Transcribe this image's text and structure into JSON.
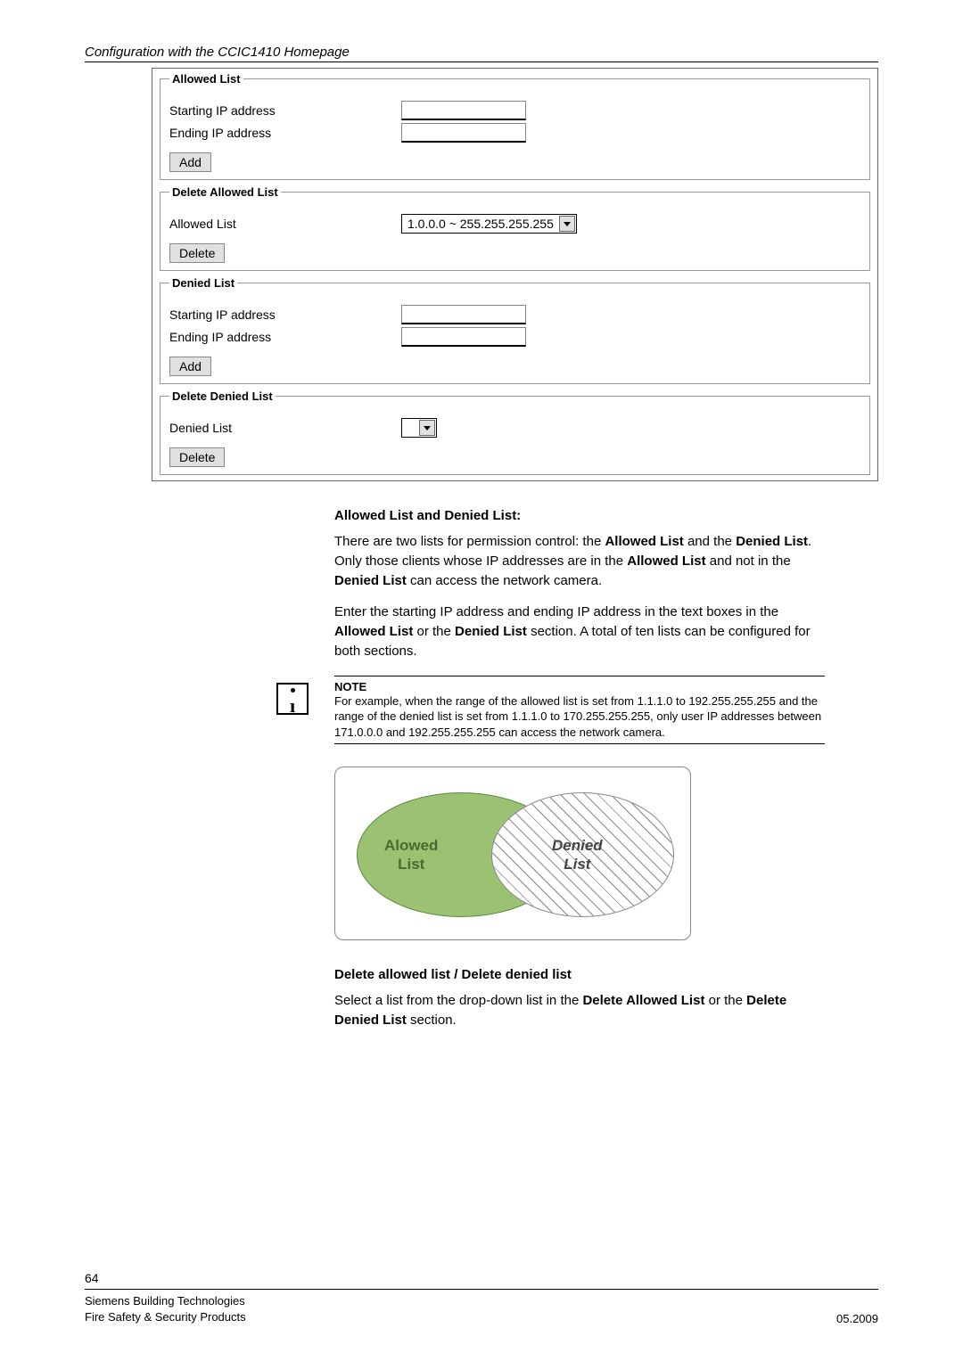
{
  "page_title": "Configuration with the CCIC1410 Homepage",
  "ui": {
    "allowed_list": {
      "legend": "Allowed List",
      "starting_ip_label": "Starting IP address",
      "ending_ip_label": "Ending IP address",
      "add_label": "Add"
    },
    "delete_allowed": {
      "legend": "Delete Allowed List",
      "allowed_list_label": "Allowed List",
      "select_value": "1.0.0.0 ~ 255.255.255.255",
      "delete_label": "Delete"
    },
    "denied_list": {
      "legend": "Denied List",
      "starting_ip_label": "Starting IP address",
      "ending_ip_label": "Ending IP address",
      "add_label": "Add"
    },
    "delete_denied": {
      "legend": "Delete Denied List",
      "denied_list_label": "Denied List",
      "delete_label": "Delete"
    }
  },
  "content": {
    "heading1": "Allowed List and Denied List:",
    "para1_a": "There are two lists for permission control: the ",
    "para1_b1": "Allowed List",
    "para1_c": " and the ",
    "para1_b2": "Denied List",
    "para1_d": ". Only those clients whose IP addresses are in the ",
    "para1_b3": "Allowed List",
    "para1_e": " and not in the ",
    "para1_b4": "Denied List",
    "para1_f": " can access the network camera.",
    "para2_a": "Enter the starting IP address and ending IP address in the text boxes in the ",
    "para2_b1": "Allowed List",
    "para2_c": " or the ",
    "para2_b2": "Denied List",
    "para2_d": " section. A total of ten lists can be configured for both sections.",
    "note_heading": "NOTE",
    "note_text": "For example, when the range of the allowed list is set from 1.1.1.0 to 192.255.255.255 and the range of the denied list is set from 1.1.1.0 to 170.255.255.255, only user IP addresses between 171.0.0.0 and 192.255.255.255 can access the network camera.",
    "diagram": {
      "allowed_label": "Alowed List",
      "denied_label": "Denied List"
    },
    "heading2": "Delete allowed list / Delete denied list",
    "para3_a": "Select a list from the drop-down list in the ",
    "para3_b1": "Delete Allowed List",
    "para3_c": " or the ",
    "para3_b2": "Delete Denied List",
    "para3_d": " section."
  },
  "footer": {
    "page_number": "64",
    "line1": "Siemens Building Technologies",
    "line2": "Fire Safety & Security Products",
    "date": "05.2009"
  }
}
